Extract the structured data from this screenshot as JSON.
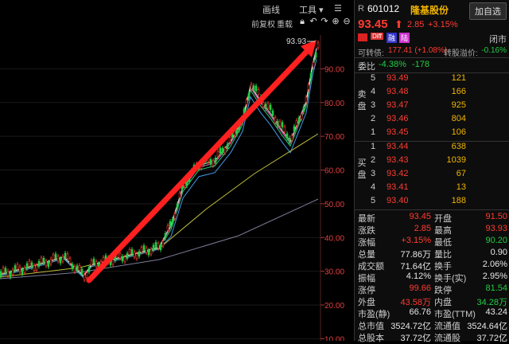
{
  "toolbar": {
    "draw": "画线",
    "tools": "工具",
    "fq": "前复权",
    "overlay": "重载"
  },
  "axis": {
    "ticks": [
      {
        "v": 90
      },
      {
        "v": 80
      },
      {
        "v": 70
      },
      {
        "v": 60
      },
      {
        "v": 50
      },
      {
        "v": 40
      },
      {
        "v": 30
      },
      {
        "v": 20
      },
      {
        "v": 10
      }
    ],
    "high_label": "93.93"
  },
  "stock": {
    "prefix": "R",
    "code": "601012",
    "name": "隆基股份",
    "add_label": "加自选",
    "price": "93.45",
    "change": "2.85",
    "pct": "+3.15%",
    "status": "闭市"
  },
  "tags": {
    "t1": "Diff",
    "t2": "融",
    "t3": "陆"
  },
  "conv": {
    "label": "可转债:",
    "value": "177.41 (+1.08%)",
    "prem_label": "转股溢价:",
    "prem": "-0.16%"
  },
  "weibi": {
    "label": "委比",
    "pct": "-4.38%",
    "diff": "-178"
  },
  "sell": [
    {
      "n": "5",
      "p": "93.49",
      "v": "121"
    },
    {
      "n": "4",
      "p": "93.48",
      "v": "166"
    },
    {
      "n": "3",
      "p": "93.47",
      "v": "925"
    },
    {
      "n": "2",
      "p": "93.46",
      "v": "804"
    },
    {
      "n": "1",
      "p": "93.45",
      "v": "106"
    }
  ],
  "buy": [
    {
      "n": "1",
      "p": "93.44",
      "v": "638"
    },
    {
      "n": "2",
      "p": "93.43",
      "v": "1039"
    },
    {
      "n": "3",
      "p": "93.42",
      "v": "67"
    },
    {
      "n": "4",
      "p": "93.41",
      "v": "13"
    },
    {
      "n": "5",
      "p": "93.40",
      "v": "188"
    }
  ],
  "sell_label": "卖盘",
  "buy_label": "买盘",
  "stats": [
    {
      "l1": "最新",
      "v1": "93.45",
      "c1": "red",
      "l2": "开盘",
      "v2": "91.50",
      "c2": "red"
    },
    {
      "l1": "涨跌",
      "v1": "2.85",
      "c1": "red",
      "l2": "最高",
      "v2": "93.93",
      "c2": "red"
    },
    {
      "l1": "涨幅",
      "v1": "+3.15%",
      "c1": "red",
      "l2": "最低",
      "v2": "90.20",
      "c2": "green"
    },
    {
      "l1": "总量",
      "v1": "77.86万",
      "c1": "white",
      "l2": "量比",
      "v2": "0.90",
      "c2": "white"
    },
    {
      "l1": "成交额",
      "v1": "71.64亿",
      "c1": "white",
      "l2": "换手",
      "v2": "2.06%",
      "c2": "white"
    },
    {
      "l1": "振幅",
      "v1": "4.12%",
      "c1": "white",
      "l2": "换手(实)",
      "v2": "2.95%",
      "c2": "white"
    },
    {
      "l1": "涨停",
      "v1": "99.66",
      "c1": "red",
      "l2": "跌停",
      "v2": "81.54",
      "c2": "green"
    },
    {
      "l1": "外盘",
      "v1": "43.58万",
      "c1": "red",
      "l2": "内盘",
      "v2": "34.28万",
      "c2": "green"
    },
    {
      "l1": "市盈(静)",
      "v1": "66.76",
      "c1": "white",
      "l2": "市盈(TTM)",
      "v2": "43.24",
      "c2": "white"
    },
    {
      "l1": "总市值",
      "v1": "3524.72亿",
      "c1": "white",
      "l2": "流通值",
      "v2": "3524.64亿",
      "c2": "white"
    },
    {
      "l1": "总股本",
      "v1": "37.72亿",
      "c1": "white",
      "l2": "流通股",
      "v2": "37.72亿",
      "c2": "white"
    }
  ]
}
